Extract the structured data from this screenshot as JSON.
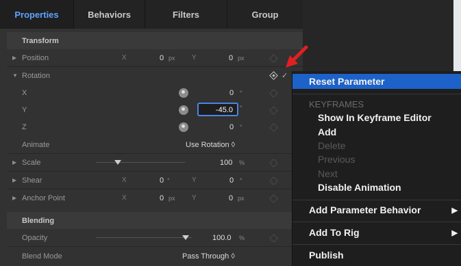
{
  "tabs": [
    "Properties",
    "Behaviors",
    "Filters",
    "Group"
  ],
  "sections": {
    "transform": "Transform",
    "blending": "Blending"
  },
  "rows": {
    "position": {
      "label": "Position",
      "x_axis": "X",
      "x_val": "0",
      "x_unit": "px",
      "y_axis": "Y",
      "y_val": "0",
      "y_unit": "px"
    },
    "rotation": {
      "label": "Rotation"
    },
    "rot_x": {
      "label": "X",
      "val": "0",
      "unit": "°"
    },
    "rot_y": {
      "label": "Y",
      "val": "-45.0",
      "unit": "°"
    },
    "rot_z": {
      "label": "Z",
      "val": "0",
      "unit": "°"
    },
    "animate": {
      "label": "Animate",
      "value": "Use Rotation ◊"
    },
    "scale": {
      "label": "Scale",
      "val": "100",
      "unit": "%"
    },
    "shear": {
      "label": "Shear",
      "x_axis": "X",
      "x_val": "0",
      "x_unit": "°",
      "y_axis": "Y",
      "y_val": "0",
      "y_unit": "°"
    },
    "anchor": {
      "label": "Anchor Point",
      "x_axis": "X",
      "x_val": "0",
      "x_unit": "px",
      "y_axis": "Y",
      "y_val": "0",
      "y_unit": "px"
    },
    "opacity": {
      "label": "Opacity",
      "val": "100.0",
      "unit": "%"
    },
    "blend_mode": {
      "label": "Blend Mode",
      "value": "Pass Through ◊"
    }
  },
  "menu": {
    "reset": "Reset Parameter",
    "keyframes_header": "KEYFRAMES",
    "show_in_editor": "Show In Keyframe Editor",
    "add": "Add",
    "delete": "Delete",
    "previous": "Previous",
    "next": "Next",
    "disable_animation": "Disable Animation",
    "add_parameter_behavior": "Add Parameter Behavior",
    "add_to_rig": "Add To Rig",
    "publish": "Publish"
  },
  "colors": {
    "accent": "#5fa3ff",
    "highlight": "#1d62c8",
    "annotation_arrow": "#e02020"
  }
}
